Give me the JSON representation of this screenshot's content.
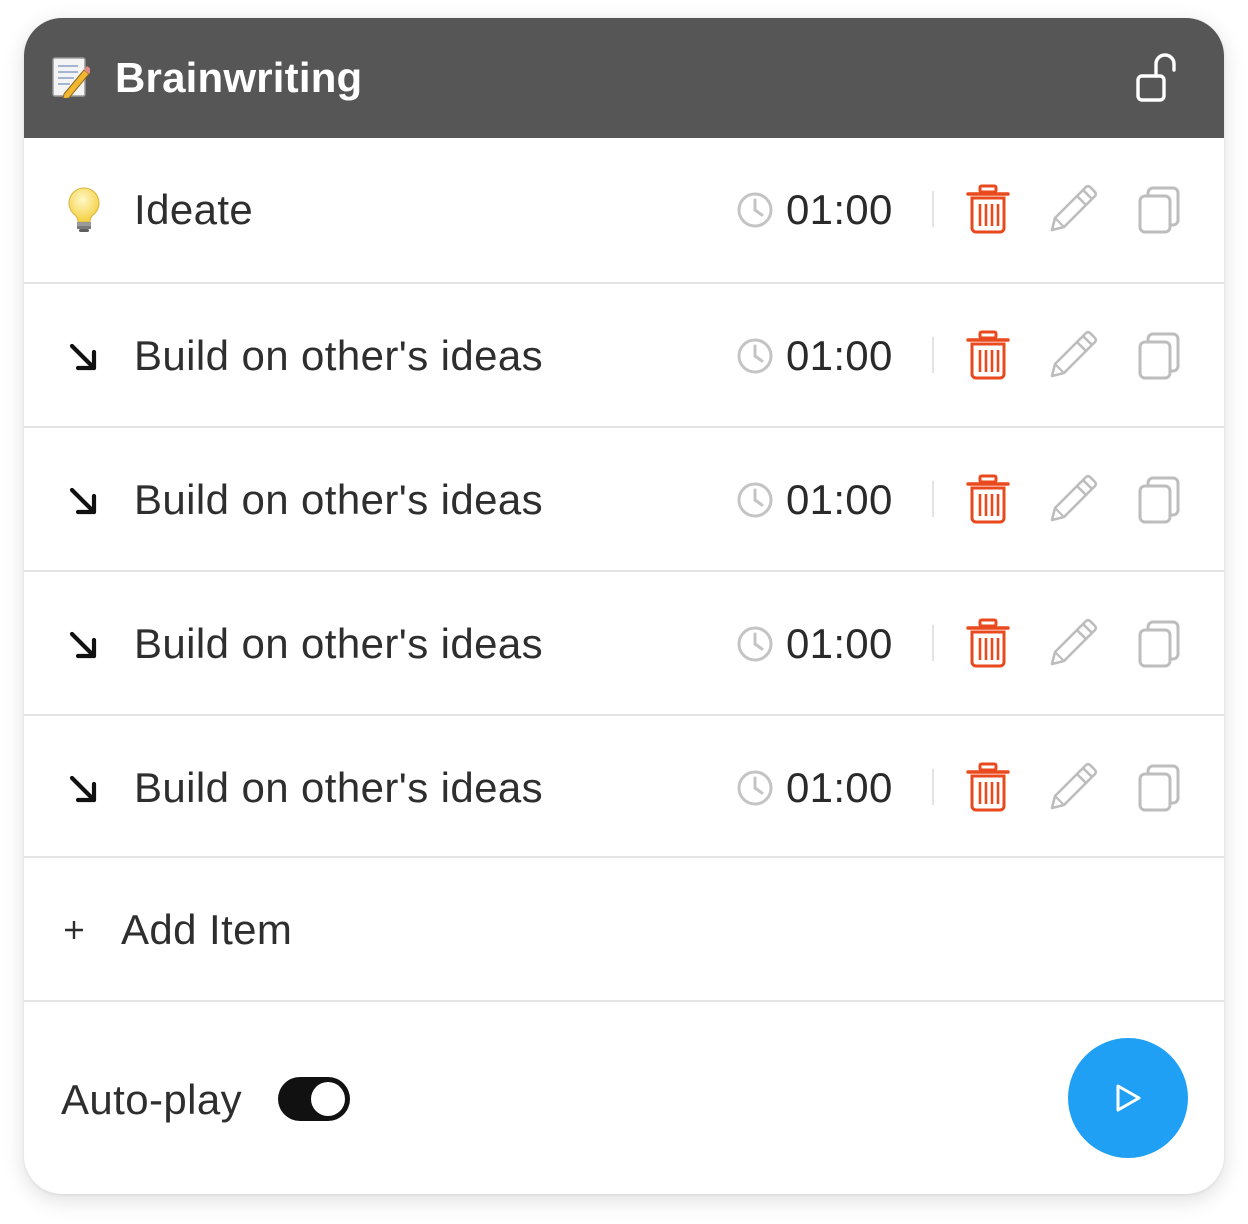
{
  "header": {
    "title": "Brainwriting",
    "icon": "memo-icon",
    "lock_icon": "unlock-icon"
  },
  "items": [
    {
      "icon": "lightbulb-icon",
      "label": "Ideate",
      "time": "01:00"
    },
    {
      "icon": "arrow-down-right-icon",
      "label": "Build on other's ideas",
      "time": "01:00"
    },
    {
      "icon": "arrow-down-right-icon",
      "label": "Build on other's ideas",
      "time": "01:00"
    },
    {
      "icon": "arrow-down-right-icon",
      "label": "Build on other's ideas",
      "time": "01:00"
    },
    {
      "icon": "arrow-down-right-icon",
      "label": "Build on other's ideas",
      "time": "01:00"
    }
  ],
  "add_item": {
    "symbol": "+",
    "label": "Add Item"
  },
  "footer": {
    "autoplay_label": "Auto-play",
    "autoplay_on": true
  },
  "colors": {
    "header_bg": "#565656",
    "delete": "#e8491d",
    "play_button": "#20a0f4",
    "muted_icon": "#bdbdbd"
  }
}
